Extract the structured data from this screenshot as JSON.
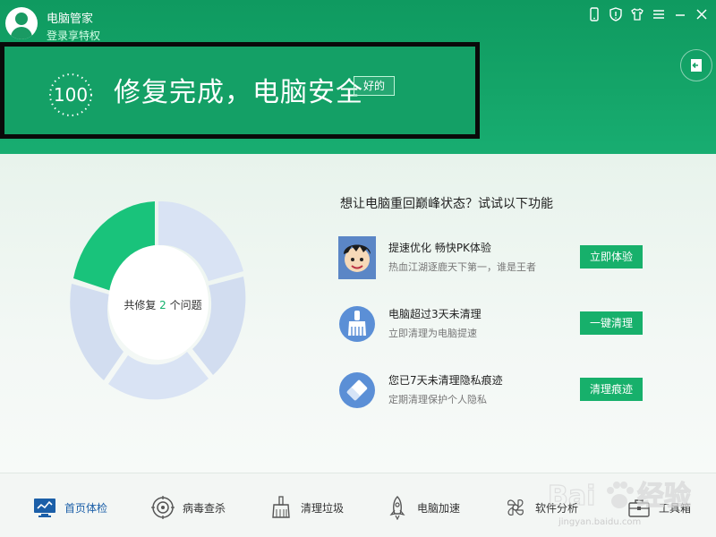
{
  "app": {
    "title": "电脑管家",
    "login_text": "登录享特权"
  },
  "status": {
    "score": "100",
    "message": "修复完成，电脑安全",
    "ok_button": "好的"
  },
  "summary": {
    "prefix": "共修复",
    "count": "2",
    "suffix": "个问题"
  },
  "promo": {
    "title": "想让电脑重回巅峰状态？试试以下功能",
    "items": [
      {
        "title": "提速优化 畅快PK体验",
        "desc": "热血江湖逐鹿天下第一，谁是王者",
        "button": "立即体验"
      },
      {
        "title": "电脑超过3天未清理",
        "desc": "立即清理为电脑提速",
        "button": "一键清理"
      },
      {
        "title": "您已7天未清理隐私痕迹",
        "desc": "定期清理保护个人隐私",
        "button": "清理痕迹"
      }
    ]
  },
  "nav": [
    {
      "label": "首页体检",
      "icon": "monitor-check-icon"
    },
    {
      "label": "病毒查杀",
      "icon": "virus-scan-icon"
    },
    {
      "label": "清理垃圾",
      "icon": "broom-icon"
    },
    {
      "label": "电脑加速",
      "icon": "rocket-icon"
    },
    {
      "label": "软件分析",
      "icon": "software-analysis-icon"
    },
    {
      "label": "工具箱",
      "icon": "toolbox-icon"
    }
  ],
  "watermark": {
    "text": "jingyan.baidu.com"
  },
  "colors": {
    "brand_green": "#14a066",
    "button_green": "#17b06b",
    "active_nav": "#1b5fa8"
  }
}
